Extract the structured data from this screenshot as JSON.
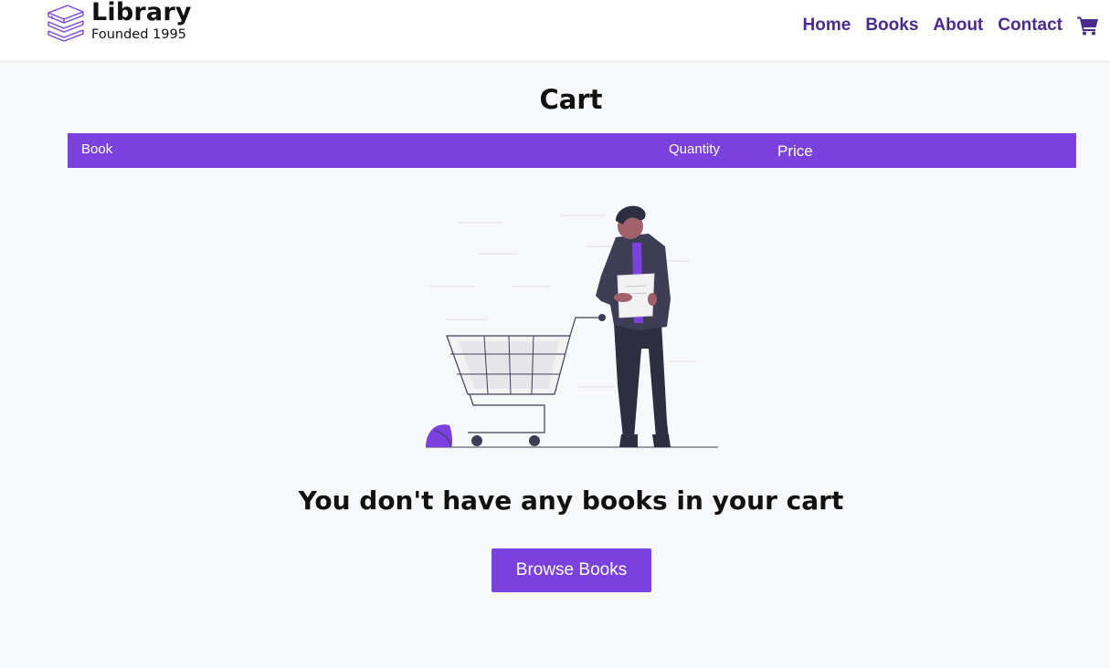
{
  "brand": {
    "title": "Library",
    "subtitle": "Founded 1995",
    "icon": "books-stack-icon"
  },
  "nav": {
    "links": [
      {
        "label": "Home"
      },
      {
        "label": "Books"
      },
      {
        "label": "About"
      },
      {
        "label": "Contact"
      }
    ],
    "cart_icon": "shopping-cart-icon"
  },
  "page": {
    "title": "Cart"
  },
  "table": {
    "columns": {
      "book": "Book",
      "quantity": "Quantity",
      "price": "Price"
    }
  },
  "empty_state": {
    "illustration": "person-with-shopping-cart-illustration",
    "message": "You don't have any books in your cart",
    "button_label": "Browse Books"
  },
  "colors": {
    "accent": "#7a41de",
    "nav_link": "#4b2a8f",
    "background": "#f7f8fa",
    "navbar": "#ffffff",
    "figure_dark": "#3f3d56",
    "figure_skin": "#a0616a"
  }
}
